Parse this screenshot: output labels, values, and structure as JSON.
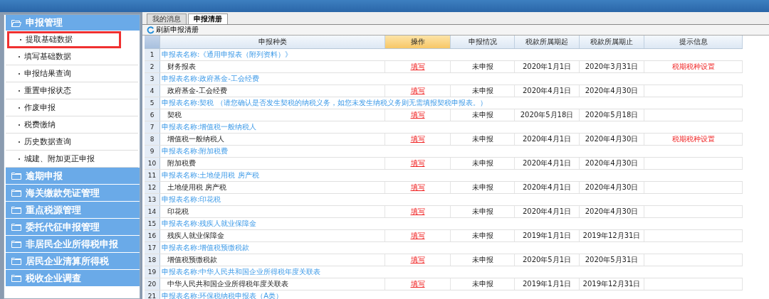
{
  "sidebar": {
    "sections": [
      {
        "label": "申报管理",
        "expanded": true,
        "items": [
          {
            "label": "提取基础数据",
            "highlighted": true
          },
          {
            "label": "填写基础数据",
            "highlighted": false
          },
          {
            "label": "申报结果查询",
            "highlighted": false
          },
          {
            "label": "重置申报状态",
            "highlighted": false
          },
          {
            "label": "作废申报",
            "highlighted": false
          },
          {
            "label": "税费缴纳",
            "highlighted": false
          },
          {
            "label": "历史数据查询",
            "highlighted": false
          },
          {
            "label": "城建、附加更正申报",
            "highlighted": false
          }
        ]
      },
      {
        "label": "逾期申报",
        "expanded": false
      },
      {
        "label": "海关缴款凭证管理",
        "expanded": false
      },
      {
        "label": "重点税源管理",
        "expanded": false
      },
      {
        "label": "委托代征申报管理",
        "expanded": false
      },
      {
        "label": "非居民企业所得税申报",
        "expanded": false
      },
      {
        "label": "居民企业清算所得税",
        "expanded": false
      },
      {
        "label": "税收企业调查",
        "expanded": false
      }
    ]
  },
  "tabs": [
    {
      "label": "我的消息",
      "selected": false
    },
    {
      "label": "申报清册",
      "selected": true
    }
  ],
  "toolbar": {
    "refresh_button": "刷新申报清册"
  },
  "table": {
    "columns": [
      {
        "label": "申报种类",
        "active": false
      },
      {
        "label": "操作",
        "active": true
      },
      {
        "label": "申报情况",
        "active": false
      },
      {
        "label": "税款所属期起",
        "active": false
      },
      {
        "label": "税款所属期止",
        "active": false
      },
      {
        "label": "提示信息",
        "active": false
      }
    ],
    "rows": [
      {
        "number": "1",
        "kind": "group",
        "text": "申报表名称:《通用申报表（附列资料）》"
      },
      {
        "number": "2",
        "kind": "item",
        "name": "财务报表",
        "action": "填写",
        "status": "未申报",
        "start": "2020年1月1日",
        "end": "2020年3月31日",
        "hint": "税期税种设置"
      },
      {
        "number": "3",
        "kind": "group",
        "text": "申报表名称:政府基金-工会经费"
      },
      {
        "number": "4",
        "kind": "item",
        "name": "政府基金-工会经费",
        "action": "填写",
        "status": "未申报",
        "start": "2020年4月1日",
        "end": "2020年4月30日"
      },
      {
        "number": "5",
        "kind": "group",
        "text": "申报表名称:契税 （请您确认是否发生契税的纳税义务，如您未发生纳税义务则无需填报契税申报表。）"
      },
      {
        "number": "6",
        "kind": "item",
        "name": "契税",
        "action": "填写",
        "status": "未申报",
        "start": "2020年5月18日",
        "end": "2020年5月18日"
      },
      {
        "number": "7",
        "kind": "group",
        "text": "申报表名称:增值税一般纳税人"
      },
      {
        "number": "8",
        "kind": "item",
        "name": "增值税一般纳税人",
        "action": "填写",
        "status": "未申报",
        "start": "2020年4月1日",
        "end": "2020年4月30日",
        "hint": "税期税种设置"
      },
      {
        "number": "9",
        "kind": "group",
        "text": "申报表名称:附加税费"
      },
      {
        "number": "10",
        "kind": "item",
        "name": "附加税费",
        "action": "填写",
        "status": "未申报",
        "start": "2020年4月1日",
        "end": "2020年4月30日"
      },
      {
        "number": "11",
        "kind": "group",
        "text": "申报表名称:土地使用税 房产税"
      },
      {
        "number": "12",
        "kind": "item",
        "name": "土地使用税 房产税",
        "action": "填写",
        "status": "未申报",
        "start": "2020年4月1日",
        "end": "2020年4月30日"
      },
      {
        "number": "13",
        "kind": "group",
        "text": "申报表名称:印花税"
      },
      {
        "number": "14",
        "kind": "item",
        "name": "印花税",
        "action": "填写",
        "status": "未申报",
        "start": "2020年4月1日",
        "end": "2020年4月30日"
      },
      {
        "number": "15",
        "kind": "group",
        "text": "申报表名称:残疾人就业保障金"
      },
      {
        "number": "16",
        "kind": "item",
        "name": "残疾人就业保障金",
        "action": "填写",
        "status": "未申报",
        "start": "2019年1月1日",
        "end": "2019年12月31日"
      },
      {
        "number": "17",
        "kind": "group",
        "text": "申报表名称:增值税预缴税款"
      },
      {
        "number": "18",
        "kind": "item",
        "name": "增值税预缴税款",
        "action": "填写",
        "status": "未申报",
        "start": "2020年5月1日",
        "end": "2020年5月31日"
      },
      {
        "number": "19",
        "kind": "group",
        "text": "申报表名称:中华人民共和国企业所得税年度关联表"
      },
      {
        "number": "20",
        "kind": "item",
        "name": "中华人民共和国企业所得税年度关联表",
        "action": "填写",
        "status": "未申报",
        "start": "2019年1月1日",
        "end": "2019年12月31日"
      },
      {
        "number": "21",
        "kind": "group",
        "text": "申报表名称:环保税纳税申报表（A类）"
      }
    ]
  }
}
